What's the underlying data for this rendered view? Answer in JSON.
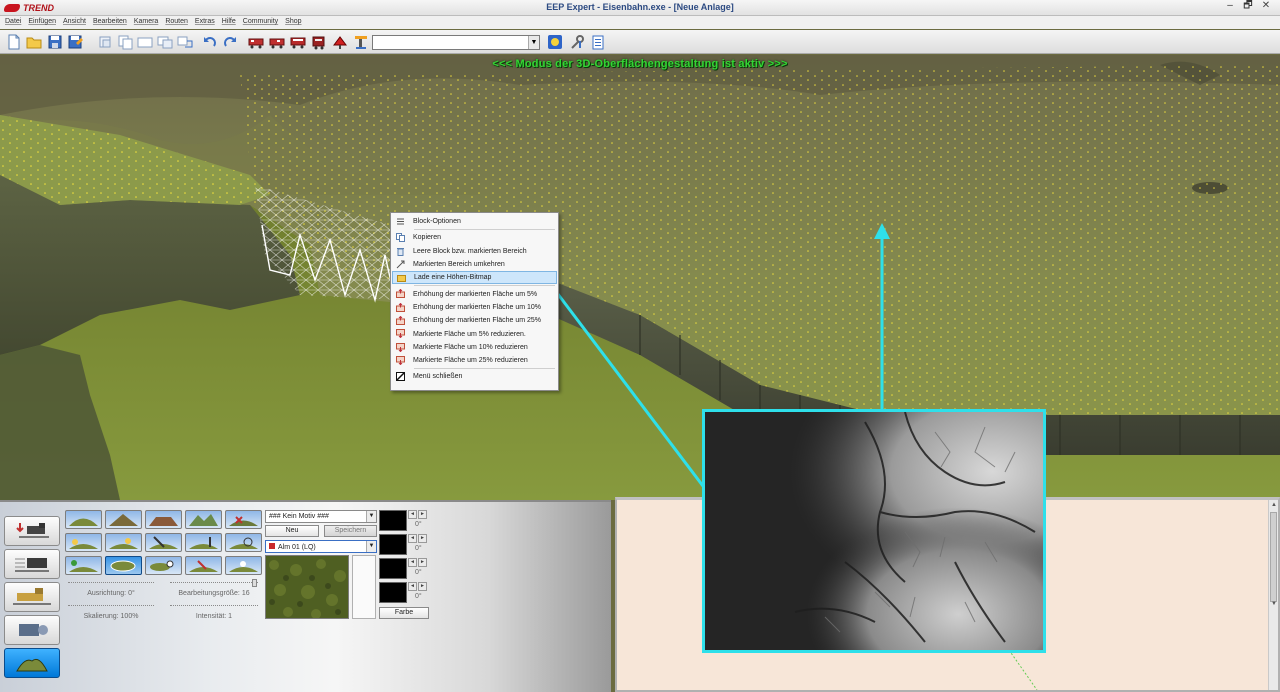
{
  "window": {
    "logo_text": "TREND",
    "title": "EEP Expert - Eisenbahn.exe - [Neue Anlage]",
    "controls": [
      "–",
      "🗗",
      "✕"
    ]
  },
  "menu": {
    "items": [
      "Datei",
      "Einfügen",
      "Ansicht",
      "Bearbeiten",
      "Kamera",
      "Routen",
      "Extras",
      "Hilfe",
      "Community",
      "Shop"
    ]
  },
  "toolbar": {
    "combo_value": "",
    "icons": [
      "new-file-icon",
      "open-folder-icon",
      "save-icon",
      "save-as-icon",
      "cut-icon",
      "copy-icon",
      "paste-icon",
      "paste-special-icon",
      "duplicate-icon",
      "undo-icon",
      "redo-icon",
      "train-icon",
      "train-icon",
      "train-icon",
      "signal-icon",
      "crane-icon",
      "camera-icon",
      "sun-icon",
      "tools-icon",
      "info-icon"
    ]
  },
  "viewport": {
    "mode_banner": "<<<  Modus der 3D-Oberflächengestaltung ist aktiv  >>>",
    "accent_color": "#2ee0ea"
  },
  "context_menu": {
    "items": [
      {
        "label": "Block-Optionen",
        "icon": "block-options-icon"
      },
      {
        "label": "Kopieren",
        "icon": "copy-icon"
      },
      {
        "label": "Leere Block bzw. markierten Bereich",
        "icon": "trash-icon"
      },
      {
        "label": "Markierten Bereich umkehren",
        "icon": "invert-icon"
      },
      {
        "label": "Lade eine Höhen-Bitmap",
        "icon": "load-bitmap-icon",
        "highlighted": true
      },
      {
        "label": "Erhöhung der markierten Fläche um 5%",
        "icon": "raise-icon"
      },
      {
        "label": "Erhöhung der markierten Fläche um 10%",
        "icon": "raise-icon"
      },
      {
        "label": "Erhöhung der markierten Fläche um 25%",
        "icon": "raise-icon"
      },
      {
        "label": "Markierte Fläche um 5% reduzieren.",
        "icon": "lower-icon"
      },
      {
        "label": "Markierte Fläche um 10% reduzieren",
        "icon": "lower-icon"
      },
      {
        "label": "Markierte Fläche um 25% reduzieren",
        "icon": "lower-icon"
      },
      {
        "label": "Menü schließen",
        "icon": "close-menu-icon"
      }
    ]
  },
  "panel": {
    "side_buttons": [
      "rail-editor-icon",
      "tram-editor-icon",
      "road-editor-icon",
      "water-editor-icon",
      "terrain-editor-icon"
    ],
    "ausrichtung": "Ausrichtung: 0°",
    "skalierung": "Skalierung: 100%",
    "bearbeitungsgroesse": "Bearbeitungsgröße: 16",
    "intensitaet": "Intensität: 1",
    "motiv_select": "### Kein Motiv ###",
    "neu_label": "Neu",
    "speichern_label": "Speichern",
    "texture_select": "Alm 01 (LQ)",
    "texture_color": "#c8282a",
    "degrees": [
      "0°",
      "0°",
      "0°",
      "0°"
    ],
    "farbe_label": "Farbe"
  }
}
